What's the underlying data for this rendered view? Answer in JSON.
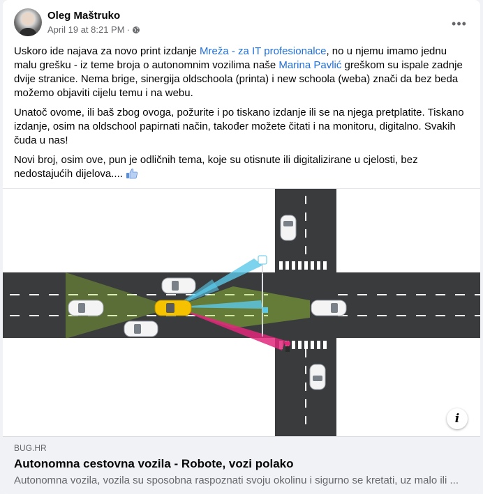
{
  "post": {
    "author": "Oleg Maštruko",
    "timestamp": "April 19 at 8:21 PM",
    "separator": "·",
    "more_label": "•••",
    "paragraph1": {
      "t1": "Uskoro ide najava za novo print izdanje ",
      "link1": "Mreža - za IT profesionalce",
      "t2": ", no u njemu imamo jednu malu grešku - iz teme broja o autonomnim vozilima naše ",
      "link2": "Marina Pavlić",
      "t3": " greškom su ispale zadnje dvije stranice. Nema brige, sinergija oldschoola (printa) i new schoola (weba) znači da bez beda možemo objaviti cijelu temu i na webu."
    },
    "paragraph2": "Unatoč ovome, ili baš zbog ovoga, požurite i po tiskano izdanje ili se na njega pretplatite. Tiskano izdanje, osim na oldschool papirnati način, također možete čitati i na monitoru, digitalno. Svakih čuda u nas!",
    "paragraph3": "Novi broj, osim ove, pun je odličnih tema, koje su otisnute ili digitalizirane u cjelosti, bez nedostajućih dijelova....",
    "info_label": "i"
  },
  "link_preview": {
    "domain": "BUG.HR",
    "title": "Autonomna cestovna vozila - Robote, vozi polako",
    "description": "Autonomna vozila, vozila su sposobna raspoznati svoju okolinu i sigurno se kretati, uz malo ili ..."
  },
  "colors": {
    "link": "#216fdb",
    "meta_text": "#65676b",
    "road": "#3a3b3d",
    "sensor_green": "#9acd32",
    "sensor_blue": "#5ac8e8",
    "sensor_pink": "#e0287a",
    "car_highlight": "#f6c200"
  }
}
